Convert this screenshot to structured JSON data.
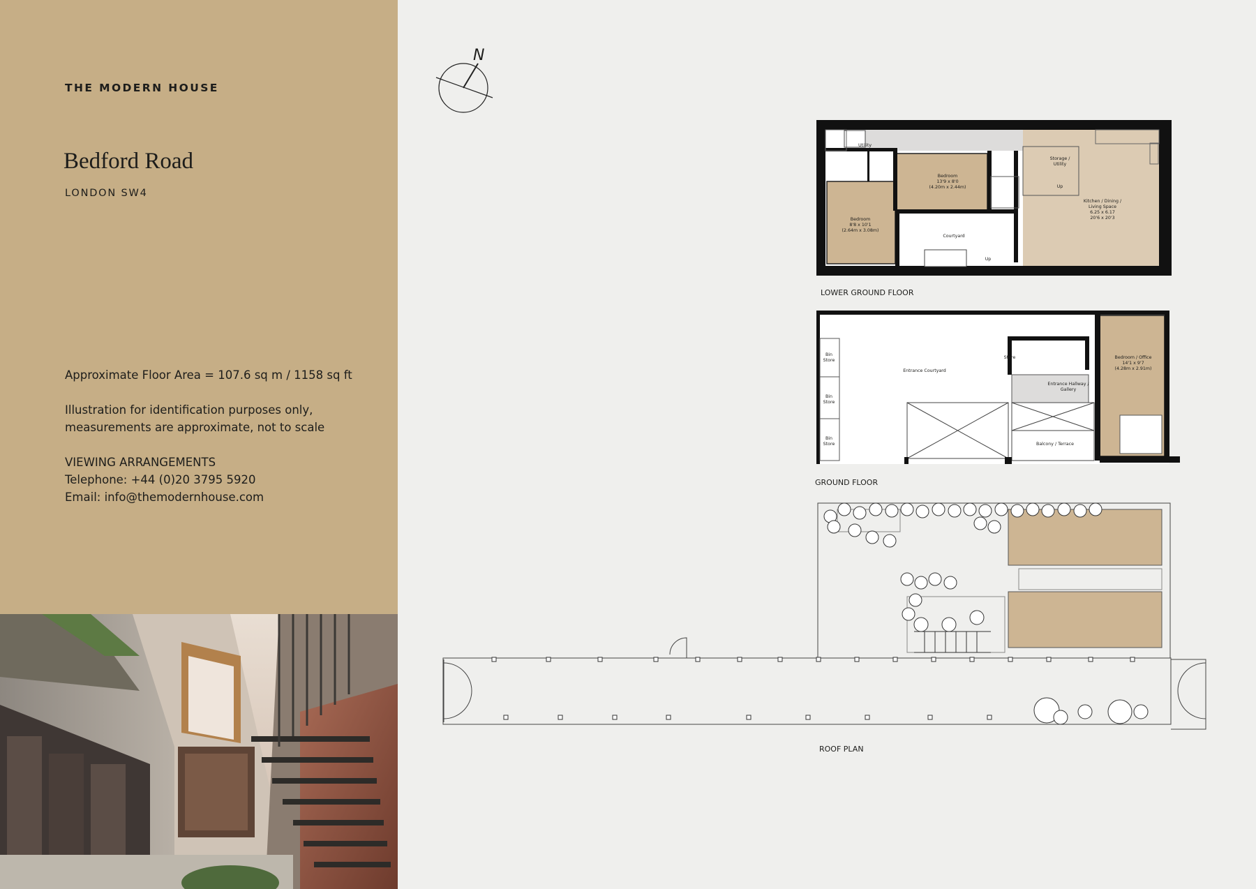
{
  "brand": "THE MODERN HOUSE",
  "property": {
    "title": "Bedford Road",
    "location": "LONDON SW4"
  },
  "info": {
    "floor_area": "Approximate Floor Area = 107.6 sq m / 1158 sq ft",
    "disclaimer_line1": "Illustration for identification purposes only,",
    "disclaimer_line2": "measurements are approximate, not to scale",
    "viewing_heading": "VIEWING ARRANGEMENTS",
    "telephone": "Telephone: +44 (0)20 3795 5920",
    "email": "Email: info@themodernhouse.com"
  },
  "compass": {
    "letter": "N"
  },
  "lower_ground": {
    "caption": "LOWER GROUND FLOOR",
    "utility": "Utility",
    "bedroom1": {
      "name": "Bedroom",
      "imperial": "13'9 x 8'0",
      "metric": "(4.20m x 2.44m)"
    },
    "bedroom2": {
      "name": "Bedroom",
      "imperial": "8'8 x 10'1",
      "metric": "(2.64m x 3.08m)"
    },
    "storage": {
      "line1": "Storage /",
      "line2": "Utility"
    },
    "up1": "Up",
    "courtyard": "Courtyard",
    "up2": "Up",
    "kitchen": {
      "line1": "Kitchen / Dining /",
      "line2": "Living Space",
      "line3": "6.25 x 6.17",
      "line4": "20'6 x 20'3"
    }
  },
  "ground": {
    "caption": "GROUND FLOOR",
    "bin": "Bin",
    "store": "Store",
    "entrance_courtyard": "Entrance Courtyard",
    "store_small": "Store",
    "hallway": {
      "line1": "Entrance Hallway /",
      "line2": "Gallery"
    },
    "balcony": "Balcony / Terrace",
    "office": {
      "line1": "Bedroom / Office",
      "line2": "14'1 x 9'7",
      "line3": "(4.28m x 2.91m)"
    }
  },
  "roof": {
    "caption": "ROOF PLAN"
  },
  "colors": {
    "sidebar": "#c6ae86",
    "room_fill": "#cdb593",
    "kitchen_fill": "#dccbb3",
    "wall": "#111111",
    "page": "#efefed"
  }
}
